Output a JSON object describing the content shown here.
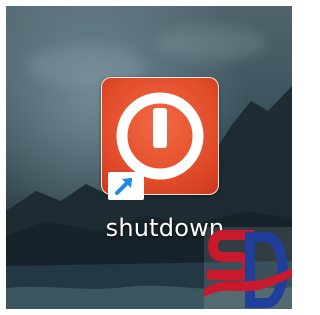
{
  "desktop": {
    "shortcut": {
      "label": "shutdown",
      "icon": "power-icon",
      "overlay_icon": "shortcut-arrow-icon",
      "tile_color": "#e24c2a"
    },
    "watermark": {
      "logo": "sd-logo",
      "colors": [
        "#c8192d",
        "#1f3f9a"
      ]
    }
  }
}
